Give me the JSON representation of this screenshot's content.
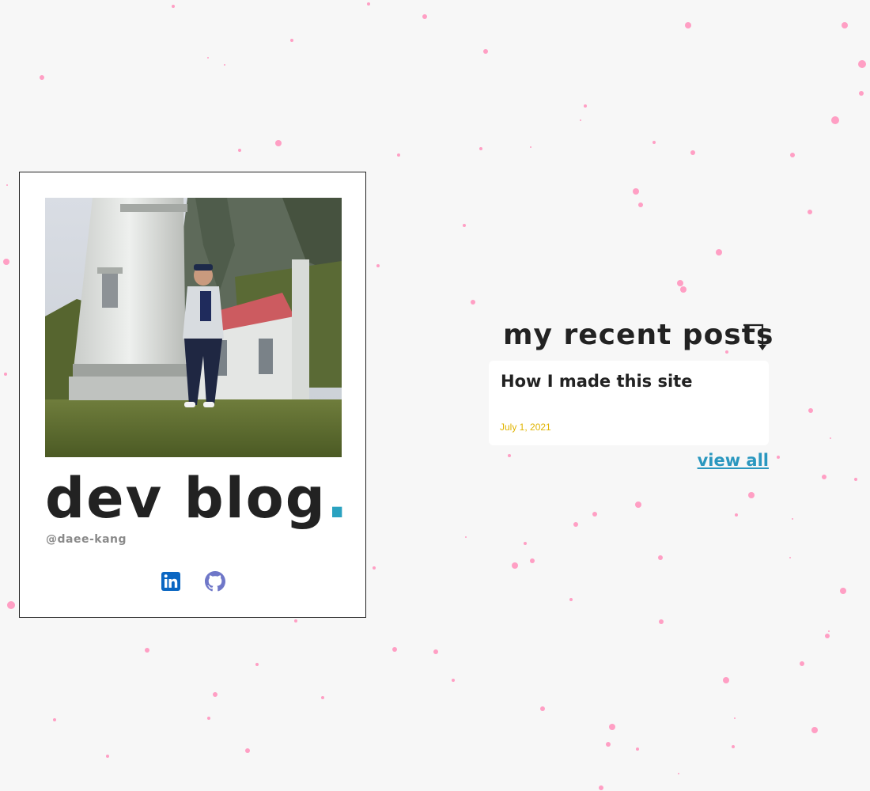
{
  "profile": {
    "title": "dev blog",
    "title_dot": ".",
    "handle": "@daee-kang",
    "photo_alt": "person standing in front of a white lighthouse",
    "socials": [
      {
        "name": "LinkedIn",
        "icon": "linkedin-icon",
        "color": "#0a66c2"
      },
      {
        "name": "GitHub",
        "icon": "github-icon",
        "color": "#6f77c8"
      }
    ]
  },
  "posts": {
    "heading": "my recent posts",
    "heading_icon": "arrow-down-right-icon",
    "items": [
      {
        "title": "How I made this site",
        "date": "July 1, 2021"
      }
    ],
    "view_all_label": "view all"
  },
  "colors": {
    "background": "#f7f7f7",
    "accent": "#2aa2c0",
    "link": "#2a97bf",
    "date": "#e0b400",
    "dots": "#ff9fc4"
  }
}
